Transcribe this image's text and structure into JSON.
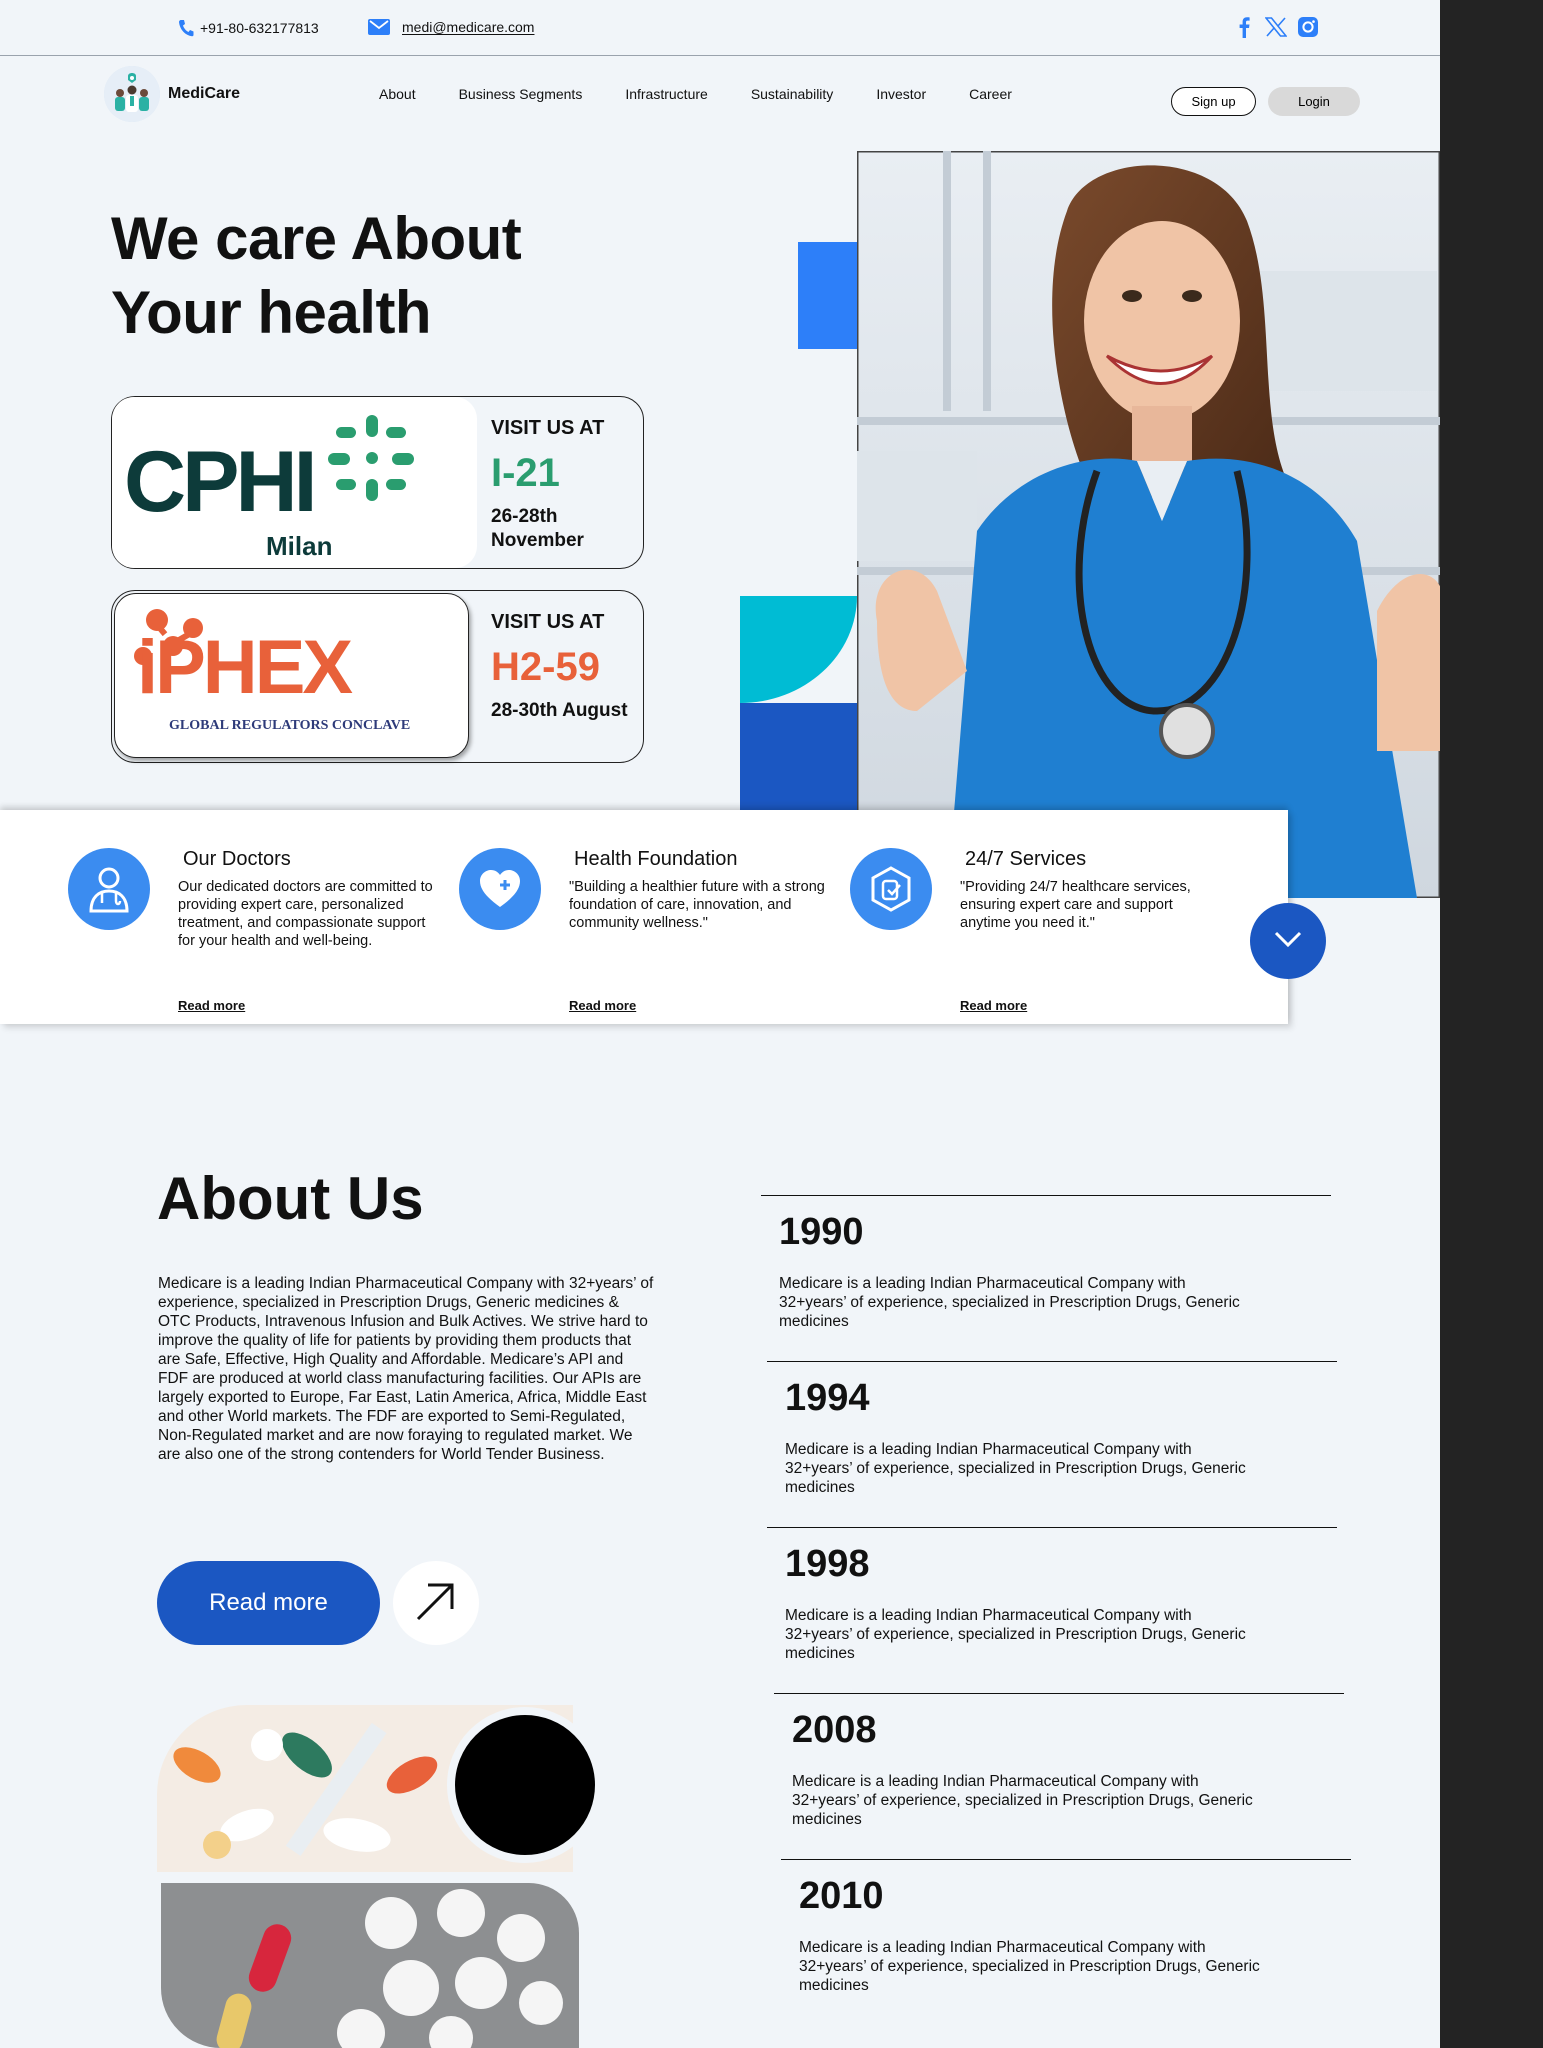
{
  "contact": {
    "phone": "+91-80-632177813",
    "email": "medi@medicare.com"
  },
  "social": [
    "facebook-icon",
    "x-icon",
    "instagram-icon"
  ],
  "brand": {
    "name": "MediCare"
  },
  "nav": {
    "items": [
      "About",
      "Business Segments",
      "Infrastructure",
      "Sustainability",
      "Investor",
      "Career"
    ],
    "signup": "Sign up",
    "login": "Login"
  },
  "hero": {
    "title_line1": "We care About",
    "title_line2": "Your health"
  },
  "events": [
    {
      "logo": "CPHI",
      "logo_sub": "Milan",
      "visit": "VISIT US AT",
      "booth": "I-21",
      "date": "26-28th November",
      "color": "#2a9d6f"
    },
    {
      "logo": "iPHEX",
      "logo_sub": "GLOBAL REGULATORS CONCLAVE",
      "visit": "VISIT US AT",
      "booth": "H2-59",
      "date": "28-30th August",
      "color": "#e8613a"
    }
  ],
  "services": [
    {
      "title": "Our Doctors",
      "desc": "Our dedicated doctors are committed to providing expert care, personalized treatment, and compassionate support for your health and well-being.",
      "link": "Read more"
    },
    {
      "title": "Health Foundation",
      "desc": "\"Building a healthier future with a strong foundation of care, innovation, and community wellness.\"",
      "link": "Read more"
    },
    {
      "title": "24/7 Services",
      "desc": "\"Providing 24/7 healthcare services, ensuring expert care and support anytime you need it.\"",
      "link": "Read more"
    }
  ],
  "about": {
    "title": "About Us",
    "text": "Medicare is a leading Indian Pharmaceutical Company with 32+years’ of experience, specialized in Prescription Drugs, Generic medicines & OTC Products, Intravenous Infusion and Bulk Actives. We strive hard to improve the quality of life for patients by providing them products that are Safe, Effective, High Quality and Affordable. Medicare’s API and FDF are produced at world class manufacturing facilities. Our APIs are largely exported to Europe, Far East, Latin America, Africa, Middle East and other World markets. The FDF are exported to Semi-Regulated, Non-Regulated market and are now foraying to regulated market. We are also one of the strong contenders for World Tender Business.",
    "read_more": "Read more"
  },
  "timeline": [
    {
      "year": "1990",
      "text": "Medicare is a leading Indian Pharmaceutical Company with 32+years’ of experience, specialized in Prescription Drugs, Generic medicines"
    },
    {
      "year": "1994",
      "text": "Medicare is a leading Indian Pharmaceutical Company with 32+years’ of experience, specialized in Prescription Drugs, Generic medicines"
    },
    {
      "year": "1998",
      "text": "Medicare is a leading Indian Pharmaceutical Company with 32+years’ of experience, specialized in Prescription Drugs, Generic medicines"
    },
    {
      "year": "2008",
      "text": "Medicare is a leading Indian Pharmaceutical Company with 32+years’ of experience, specialized in Prescription Drugs, Generic medicines"
    },
    {
      "year": "2010",
      "text": "Medicare is a leading Indian Pharmaceutical Company with 32+years’ of experience, specialized in Prescription Drugs, Generic medicines"
    }
  ],
  "colors": {
    "primary": "#1b57c2",
    "accent": "#2d7ff9",
    "cyan": "#00bcd4",
    "background": "#f1f5f9"
  }
}
